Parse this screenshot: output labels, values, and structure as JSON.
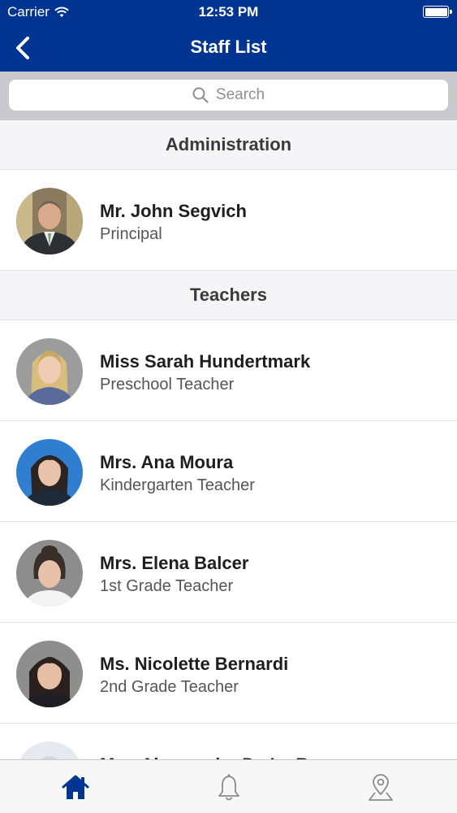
{
  "status_bar": {
    "carrier": "Carrier",
    "time": "12:53 PM",
    "battery_level": 1.0
  },
  "nav": {
    "title": "Staff List",
    "back_icon": "chevron-left-icon"
  },
  "search": {
    "placeholder": "Search",
    "icon": "search-icon"
  },
  "sections": [
    {
      "title": "Administration",
      "people": [
        {
          "name": "Mr. John Segvich",
          "role": "Principal"
        }
      ]
    },
    {
      "title": "Teachers",
      "people": [
        {
          "name": "Miss Sarah Hundertmark",
          "role": "Preschool Teacher"
        },
        {
          "name": "Mrs. Ana Moura",
          "role": "Kindergarten Teacher"
        },
        {
          "name": "Mrs. Elena Balcer",
          "role": "1st Grade Teacher"
        },
        {
          "name": "Ms. Nicolette Bernardi",
          "role": "2nd Grade Teacher"
        },
        {
          "name": "Mrs. Alessandra De La R...",
          "role": ""
        }
      ]
    }
  ],
  "tab_bar": {
    "active_color": "#023591",
    "inactive_color": "#8a8a8e",
    "tabs": [
      {
        "icon": "home-icon",
        "active": true
      },
      {
        "icon": "bell-icon",
        "active": false
      },
      {
        "icon": "map-pin-icon",
        "active": false
      }
    ]
  },
  "colors": {
    "brand": "#023591",
    "section_bg": "#f5f5f7",
    "search_bg": "#c8c8cd"
  }
}
